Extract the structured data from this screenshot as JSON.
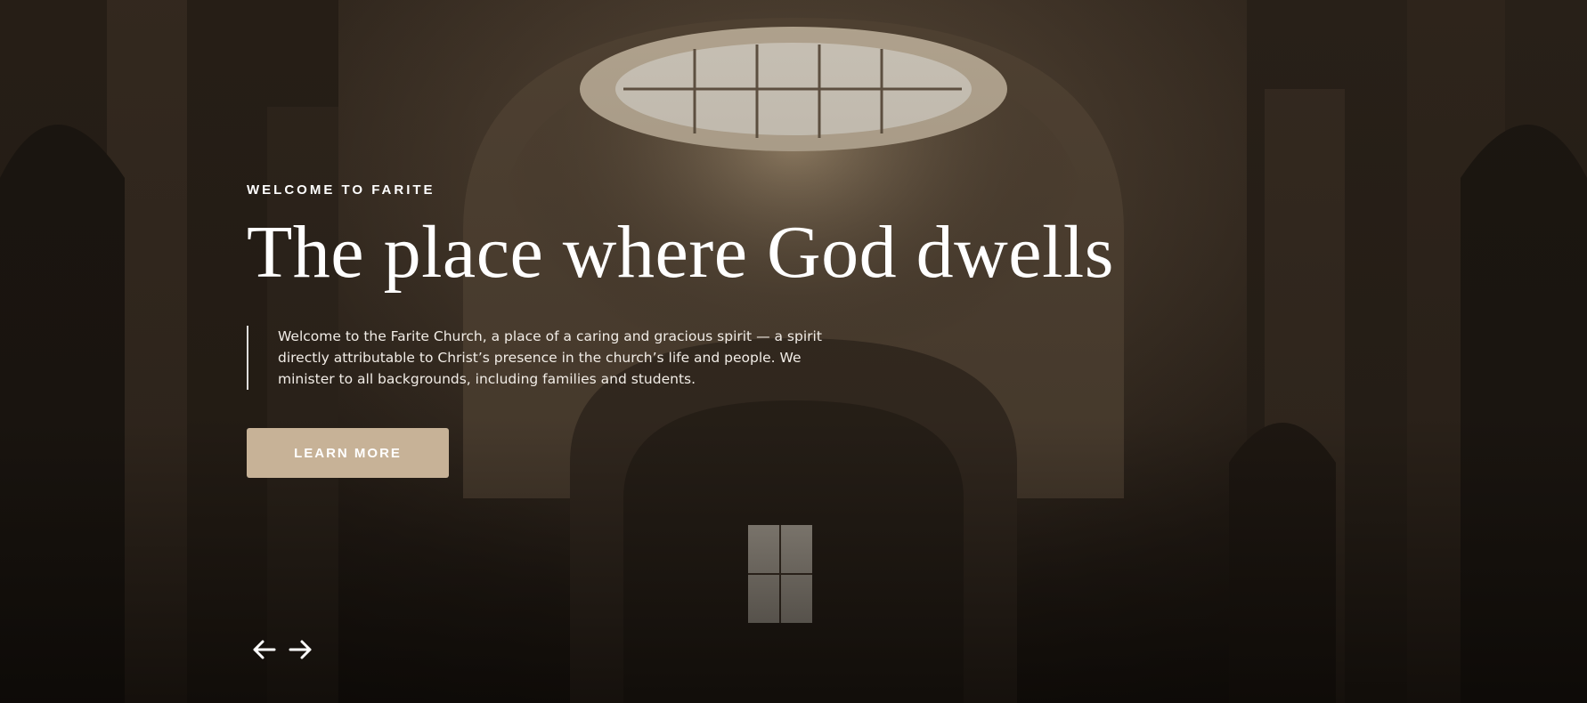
{
  "hero": {
    "eyebrow": "WELCOME TO FARITE",
    "headline": "The place where God dwells",
    "description": "Welcome to the Farite Church, a place of a caring and gracious spirit — a spirit directly attributable to Christ’s presence in the church’s life and people. We minister to all backgrounds, including families and students.",
    "cta_label": "LEARN MORE"
  },
  "slider": {
    "prev_icon": "arrow-left-icon",
    "next_icon": "arrow-right-icon"
  },
  "colors": {
    "accent": "#c7b297",
    "text": "#ffffff",
    "background_dark": "#14100c"
  }
}
